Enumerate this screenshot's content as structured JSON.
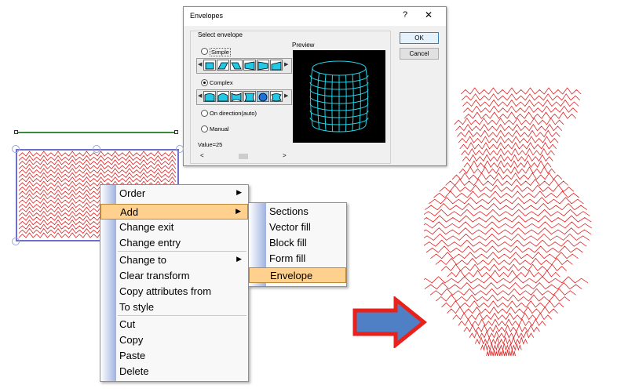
{
  "dialog": {
    "title": "Envelopes",
    "help": "?",
    "close": "✕",
    "group_label": "Select envelope",
    "preview_label": "Preview",
    "ok": "OK",
    "cancel": "Cancel",
    "options": [
      {
        "label": "Simple",
        "checked": false
      },
      {
        "label": "Complex",
        "checked": true
      },
      {
        "label": "On direction(auto)",
        "checked": false
      },
      {
        "label": "Manual",
        "checked": false
      }
    ],
    "value_label": "Value=25",
    "scroll_left": "<",
    "scroll_right": ">",
    "preview_color": "#22d3e6"
  },
  "context_menu": {
    "items": [
      {
        "label": "Order",
        "submenu": true
      },
      {
        "label": "Add",
        "submenu": true,
        "highlighted": true
      },
      {
        "label": "Change exit"
      },
      {
        "label": "Change entry"
      },
      {
        "label": "Change to",
        "submenu": true
      },
      {
        "label": "Clear transform"
      },
      {
        "label": "Copy attributes from"
      },
      {
        "label": "To style"
      },
      {
        "label": "Cut"
      },
      {
        "label": "Copy"
      },
      {
        "label": "Paste"
      },
      {
        "label": "Delete"
      }
    ],
    "submenu_arrow": "▶"
  },
  "add_submenu": {
    "items": [
      {
        "label": "Sections"
      },
      {
        "label": "Vector fill"
      },
      {
        "label": "Block fill"
      },
      {
        "label": "Form fill"
      },
      {
        "label": "Envelope",
        "highlighted": true
      }
    ]
  },
  "colors": {
    "stitch": "#e02424",
    "arrow_fill": "#4f7fc4",
    "arrow_stroke": "#e8211b",
    "selection": "#6b70c8",
    "highlight": "#ffd08e"
  }
}
